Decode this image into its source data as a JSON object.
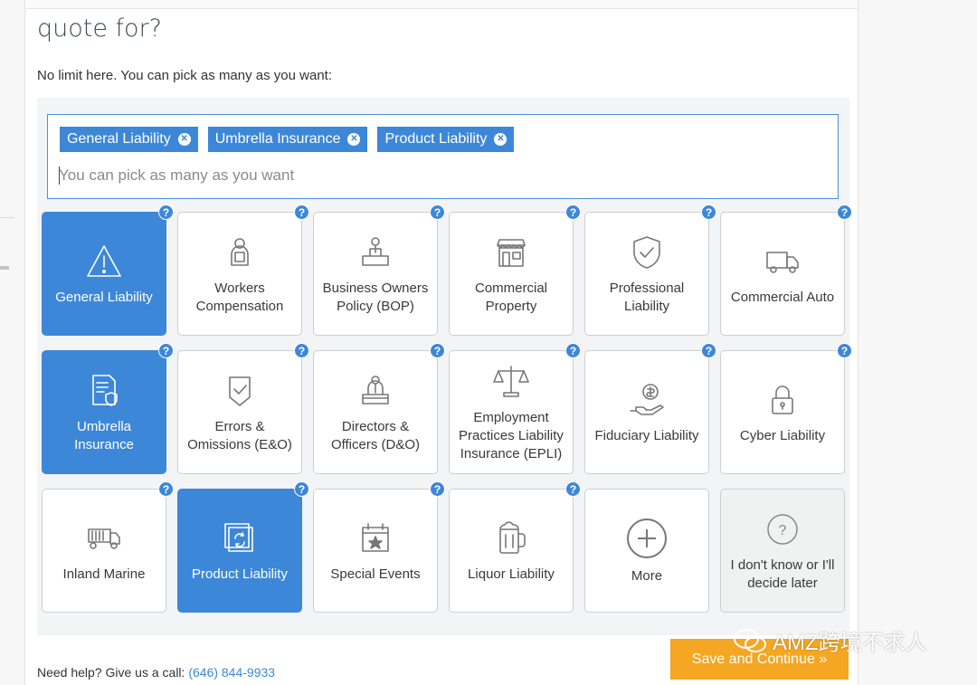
{
  "page": {
    "heading": "quote for?",
    "subtext": "No limit here. You can pick as many as you want:"
  },
  "selector": {
    "chips": [
      {
        "label": "General Liability"
      },
      {
        "label": "Umbrella Insurance"
      },
      {
        "label": "Product Liability"
      }
    ],
    "placeholder": "You can pick as many as you want"
  },
  "tiles": [
    {
      "label": "General Liability",
      "icon": "warning-triangle-icon",
      "selected": true,
      "help": true
    },
    {
      "label": "Workers Compensation",
      "icon": "worker-icon",
      "selected": false,
      "help": true
    },
    {
      "label": "Business Owners Policy (BOP)",
      "icon": "business-owner-icon",
      "selected": false,
      "help": true
    },
    {
      "label": "Commercial Property",
      "icon": "storefront-icon",
      "selected": false,
      "help": true
    },
    {
      "label": "Professional Liability",
      "icon": "shield-check-icon",
      "selected": false,
      "help": true
    },
    {
      "label": "Commercial Auto",
      "icon": "truck-icon",
      "selected": false,
      "help": true
    },
    {
      "label": "Umbrella Insurance",
      "icon": "document-shield-icon",
      "selected": true,
      "help": true
    },
    {
      "label": "Errors & Omissions (E&O)",
      "icon": "badge-check-icon",
      "selected": false,
      "help": true
    },
    {
      "label": "Directors & Officers (D&O)",
      "icon": "director-icon",
      "selected": false,
      "help": true
    },
    {
      "label": "Employment Practices Liability Insurance (EPLI)",
      "icon": "scales-icon",
      "selected": false,
      "help": true
    },
    {
      "label": "Fiduciary Liability",
      "icon": "hand-coin-icon",
      "selected": false,
      "help": true
    },
    {
      "label": "Cyber Liability",
      "icon": "padlock-icon",
      "selected": false,
      "help": true
    },
    {
      "label": "Inland Marine",
      "icon": "dump-truck-icon",
      "selected": false,
      "help": true
    },
    {
      "label": "Product Liability",
      "icon": "product-box-icon",
      "selected": true,
      "help": true
    },
    {
      "label": "Special Events",
      "icon": "calendar-star-icon",
      "selected": false,
      "help": true
    },
    {
      "label": "Liquor Liability",
      "icon": "beer-mug-icon",
      "selected": false,
      "help": true
    },
    {
      "label": "More",
      "icon": "plus-circle-icon",
      "selected": false,
      "help": false
    },
    {
      "label": "I don't know or I'll decide later",
      "icon": "question-circle-icon",
      "selected": false,
      "help": false
    }
  ],
  "footer": {
    "help_text": "Need help? Give us a call:",
    "phone": "(646) 844-9933",
    "save_label": "Save and Continue »"
  },
  "watermark": {
    "text": "AMZ跨境不求人"
  },
  "colors": {
    "accent": "#3d87d9",
    "button": "#f5a623",
    "border": "#cfcfcf"
  }
}
